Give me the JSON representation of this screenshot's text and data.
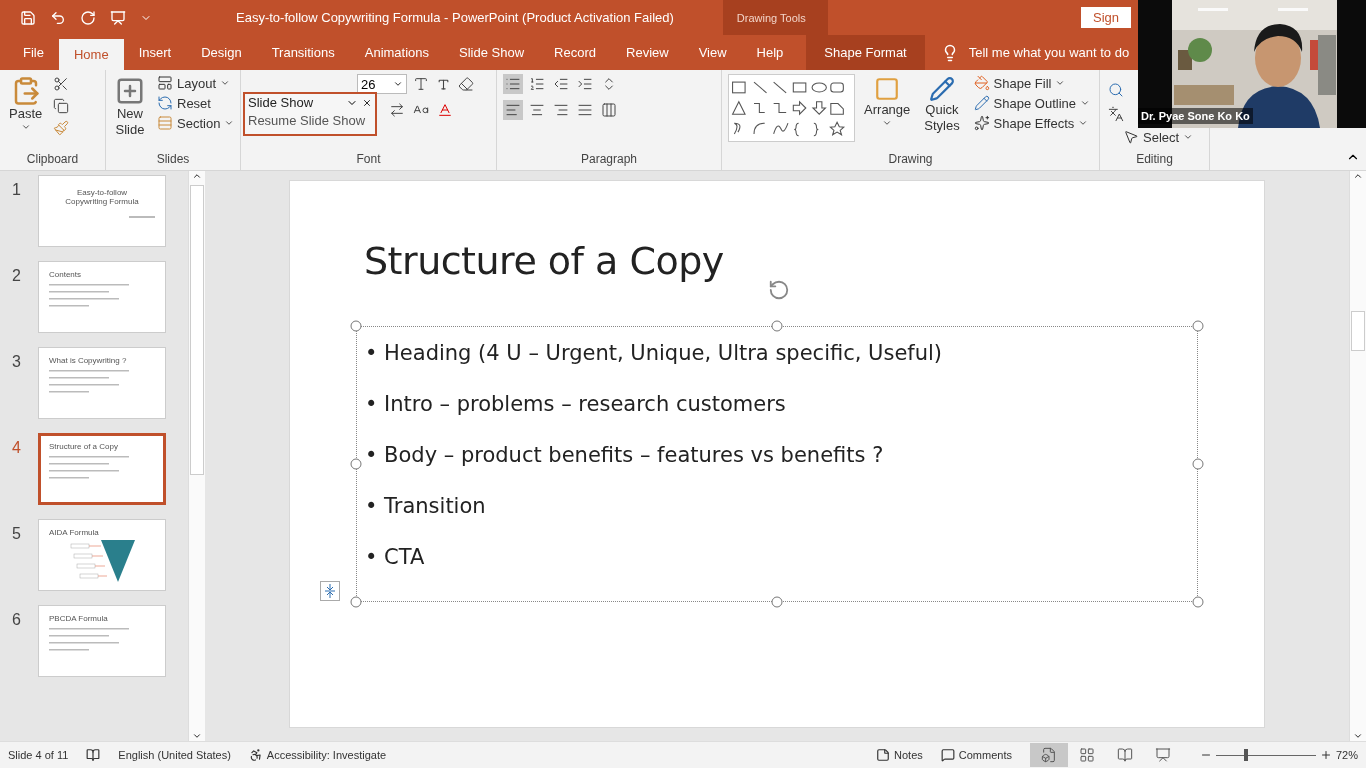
{
  "title_bar": {
    "title": "Easy-to-follow Copywriting Formula  -  PowerPoint (Product Activation Failed)",
    "context_label": "Drawing Tools",
    "sign_in": "Sign"
  },
  "tabs": [
    {
      "label": "File",
      "selected": false,
      "kind": "normal"
    },
    {
      "label": "Home",
      "selected": true,
      "kind": "normal"
    },
    {
      "label": "Insert",
      "selected": false,
      "kind": "normal"
    },
    {
      "label": "Design",
      "selected": false,
      "kind": "normal"
    },
    {
      "label": "Transitions",
      "selected": false,
      "kind": "normal"
    },
    {
      "label": "Animations",
      "selected": false,
      "kind": "normal"
    },
    {
      "label": "Slide Show",
      "selected": false,
      "kind": "normal"
    },
    {
      "label": "Record",
      "selected": false,
      "kind": "normal"
    },
    {
      "label": "Review",
      "selected": false,
      "kind": "normal"
    },
    {
      "label": "View",
      "selected": false,
      "kind": "normal"
    },
    {
      "label": "Help",
      "selected": false,
      "kind": "normal"
    },
    {
      "label": "Shape Format",
      "selected": false,
      "kind": "contextual"
    }
  ],
  "tell_me": "Tell me what you want to do",
  "ribbon": {
    "clipboard": {
      "label": "Clipboard",
      "paste": "Paste"
    },
    "slides": {
      "label": "Slides",
      "new_slide": "New Slide",
      "layout": "Layout",
      "reset": "Reset",
      "section": "Section"
    },
    "font": {
      "label": "Font",
      "size": "26",
      "popup": {
        "title": "Slide Show",
        "action": "Resume Slide Show"
      }
    },
    "paragraph": {
      "label": "Paragraph"
    },
    "drawing": {
      "label": "Drawing",
      "arrange": "Arrange",
      "quick_styles": "Quick Styles",
      "shape_fill": "Shape Fill",
      "shape_outline": "Shape Outline",
      "shape_effects": "Shape Effects"
    },
    "editing": {
      "label": "Editing",
      "select": "Select"
    }
  },
  "thumbnails": [
    {
      "number": "1",
      "selected": false,
      "kind": "title",
      "title": "Easy-to-follow Copywriting Formula"
    },
    {
      "number": "2",
      "selected": false,
      "kind": "bullets",
      "title": "Contents"
    },
    {
      "number": "3",
      "selected": false,
      "kind": "bullets",
      "title": "What is Copywriting ?"
    },
    {
      "number": "4",
      "selected": true,
      "kind": "bullets",
      "title": "Structure of a Copy"
    },
    {
      "number": "5",
      "selected": false,
      "kind": "funnel",
      "title": "AIDA Formula"
    },
    {
      "number": "6",
      "selected": false,
      "kind": "bullets",
      "title": "PBCDA Formula"
    }
  ],
  "slide": {
    "title": "Structure of a Copy",
    "bullets": [
      "• Heading (4 U – Urgent, Unique, Ultra specific, Useful)",
      "• Intro – problems – research customers",
      "• Body – product benefits – features vs benefits ?",
      "• Transition",
      "• CTA"
    ]
  },
  "status_bar": {
    "slide_info": "Slide 4 of 11",
    "language": "English (United States)",
    "accessibility": "Accessibility: Investigate",
    "notes": "Notes",
    "comments": "Comments",
    "views": [
      {
        "kind": "normal",
        "selected": true
      },
      {
        "kind": "sorter",
        "selected": false
      },
      {
        "kind": "reading",
        "selected": false
      },
      {
        "kind": "slideshow",
        "selected": false
      }
    ],
    "zoom": {
      "level": 0.3,
      "reading": "72%"
    }
  },
  "webcam": {
    "kind": "picture",
    "name": "Dr. Pyae Sone Ko Ko"
  }
}
